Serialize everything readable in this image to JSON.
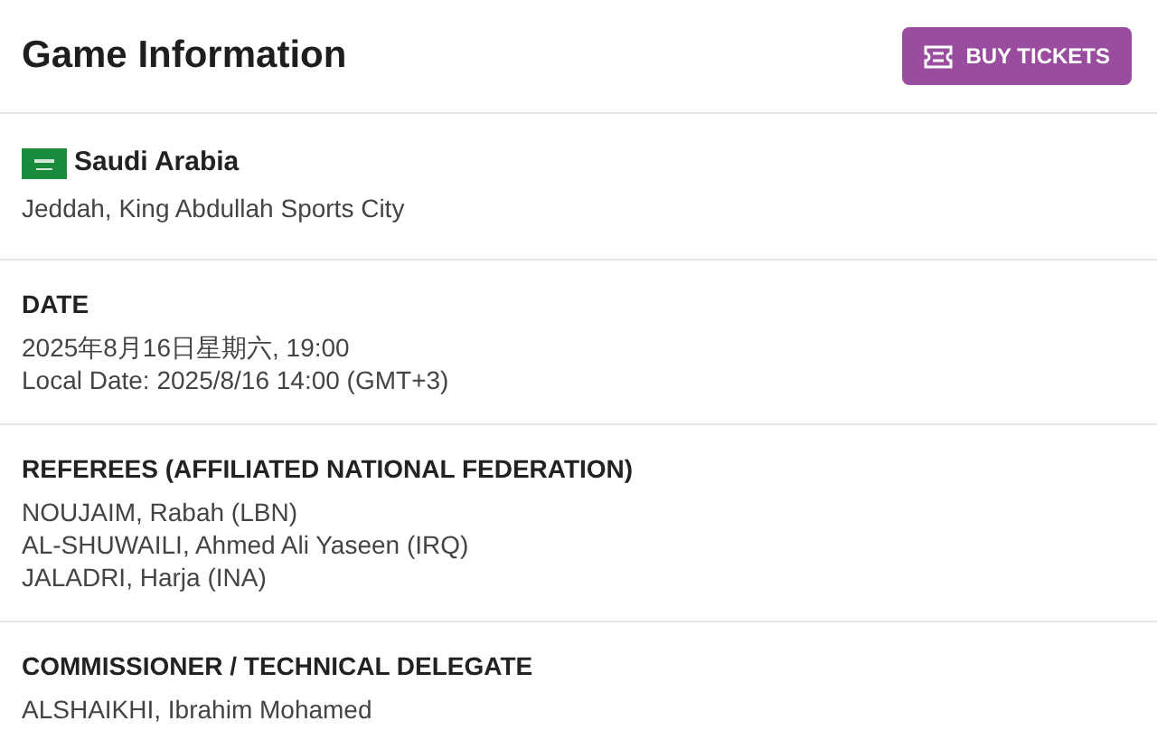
{
  "header": {
    "title": "Game Information",
    "button": "BUY TICKETS"
  },
  "venue": {
    "country": "Saudi Arabia",
    "city": "Jeddah, King Abdullah Sports City"
  },
  "sections": [
    {
      "heading": "DATE",
      "lines": [
        "2025年8月16日星期六, 19:00",
        "Local Date: 2025/8/16 14:00 (GMT+3)"
      ]
    },
    {
      "heading": "REFEREES (AFFILIATED NATIONAL FEDERATION)",
      "lines": [
        "NOUJAIM, Rabah (LBN)",
        "AL-SHUWAILI, Ahmed Ali Yaseen (IRQ)",
        "JALADRI, Harja (INA)"
      ]
    },
    {
      "heading": "COMMISSIONER / TECHNICAL DELEGATE",
      "lines": [
        "ALSHAIKHI, Ibrahim Mohamed"
      ]
    }
  ]
}
